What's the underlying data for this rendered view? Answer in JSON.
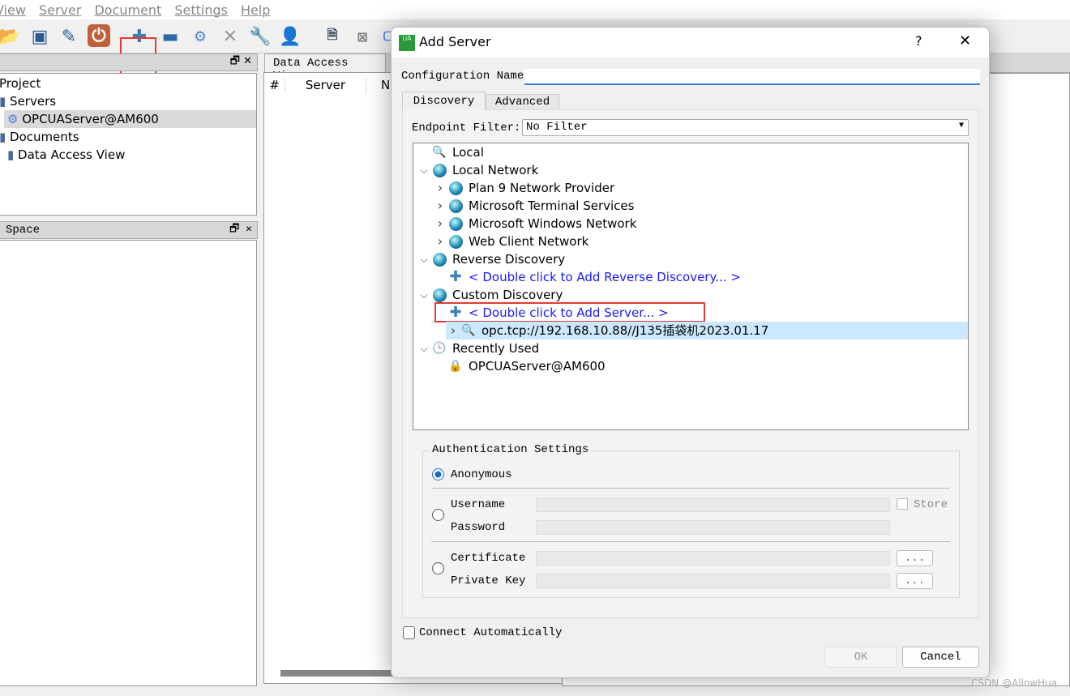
{
  "menu": [
    "View",
    "Server",
    "Document",
    "Settings",
    "Help"
  ],
  "toolbar": {
    "icons": [
      "open-folder-icon",
      "save-icon",
      "edit-icon",
      "power-icon",
      "add-server-icon",
      "remove-server-icon",
      "connect-icon",
      "disconnect-icon",
      "settings-wrench-icon",
      "user-icon",
      "document-icon",
      "close-document-icon",
      "monitor-icon"
    ]
  },
  "project_panel": {
    "title": "",
    "items": [
      "Project",
      "Servers",
      "OPCUAServer@AM600",
      "Documents",
      "Data Access View"
    ]
  },
  "space_panel": {
    "title": "Space"
  },
  "data_access": {
    "tab": "Data Access View",
    "columns": [
      "#",
      "Server",
      "N"
    ]
  },
  "dialog": {
    "title": "Add Server",
    "help": "?",
    "close": "✕",
    "config_label": "Configuration Name",
    "config_value": "",
    "tabs": [
      "Discovery",
      "Advanced"
    ],
    "filter_label": "Endpoint Filter:",
    "filter_value": "No Filter",
    "tree": [
      {
        "label": "Local",
        "level": 0,
        "icon": "search-icon",
        "chevron": ""
      },
      {
        "label": "Local Network",
        "level": 0,
        "icon": "globe-icon",
        "chevron": "expanded"
      },
      {
        "label": "Plan 9 Network Provider",
        "level": 1,
        "icon": "globe-icon",
        "chevron": "collapsed"
      },
      {
        "label": "Microsoft Terminal Services",
        "level": 1,
        "icon": "globe-icon",
        "chevron": "collapsed"
      },
      {
        "label": "Microsoft Windows Network",
        "level": 1,
        "icon": "globe-icon",
        "chevron": "collapsed"
      },
      {
        "label": "Web Client Network",
        "level": 1,
        "icon": "globe-icon",
        "chevron": "collapsed"
      },
      {
        "label": "Reverse Discovery",
        "level": 0,
        "icon": "globe-icon",
        "chevron": "expanded"
      },
      {
        "label": "< Double click to Add Reverse Discovery... >",
        "level": 1,
        "icon": "plus-icon",
        "chevron": "",
        "link": true
      },
      {
        "label": "Custom Discovery",
        "level": 0,
        "icon": "globe-icon",
        "chevron": "expanded"
      },
      {
        "label": "< Double click to Add Server... >",
        "level": 1,
        "icon": "plus-icon",
        "chevron": "",
        "link": true,
        "highlight": true
      },
      {
        "label": "opc.tcp://192.168.10.88//J135插袋机2023.01.17",
        "level": 1,
        "icon": "search-icon",
        "chevron": "collapsed",
        "selected": true
      },
      {
        "label": "Recently Used",
        "level": 0,
        "icon": "clock-icon",
        "chevron": "expanded"
      },
      {
        "label": "OPCUAServer@AM600",
        "level": 1,
        "icon": "lock-icon",
        "chevron": ""
      }
    ],
    "auth": {
      "title": "Authentication Settings",
      "anonymous": "Anonymous",
      "username": "Username",
      "password": "Password",
      "store": "Store",
      "certificate": "Certificate",
      "private_key": "Private Key",
      "browse": "...",
      "selected": "Anonymous"
    },
    "connect_auto": "Connect Automatically",
    "ok": "OK",
    "cancel": "Cancel"
  },
  "watermark": "CSDN @AllowHua",
  "colors": {
    "highlight_box": "#e53935",
    "link": "#1a1aff",
    "selection": "#cce8ff"
  }
}
